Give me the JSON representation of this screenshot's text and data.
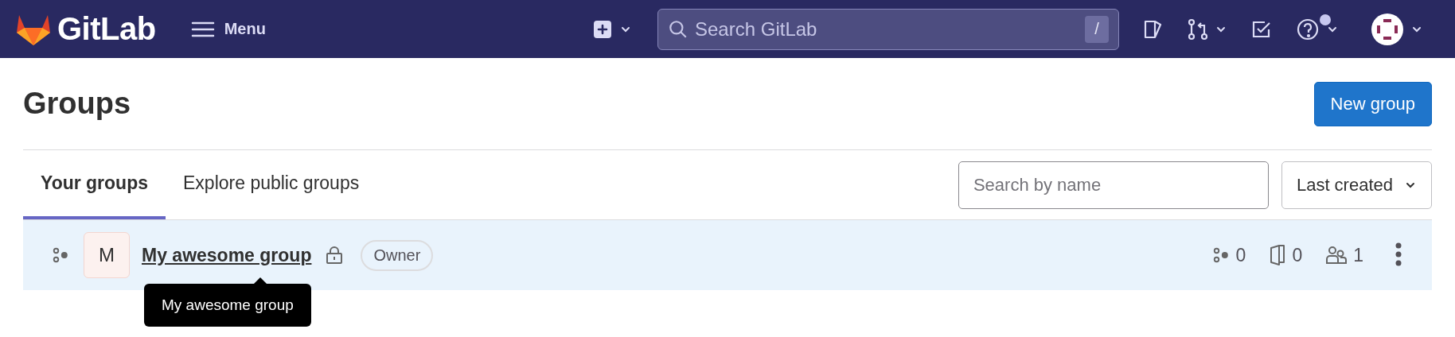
{
  "navbar": {
    "brand": "GitLab",
    "menu": "Menu",
    "search": {
      "placeholder": "Search GitLab",
      "shortcut": "/"
    },
    "help_badge": true
  },
  "page": {
    "title": "Groups",
    "new_button": "New group"
  },
  "tabs": [
    {
      "label": "Your groups",
      "selected": true
    },
    {
      "label": "Explore public groups",
      "selected": false
    }
  ],
  "filter": {
    "placeholder": "Search by name",
    "sort": "Last created"
  },
  "groups": [
    {
      "avatar": "M",
      "name": "My awesome group",
      "private": true,
      "role": "Owner",
      "subgroups": "0",
      "projects": "0",
      "members": "1",
      "hovered": true,
      "tooltip": "My awesome group"
    }
  ]
}
